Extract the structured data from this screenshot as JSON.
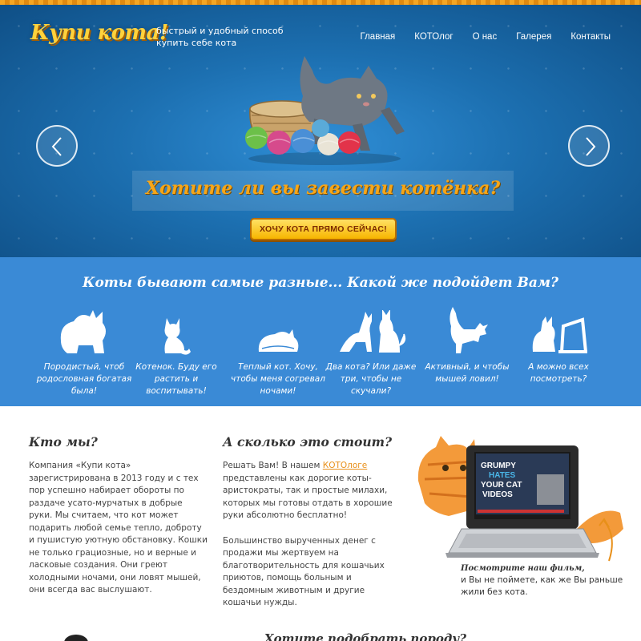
{
  "header": {
    "logo": "Купи кота!",
    "tagline": "быстрый и удобный способ купить себе кота",
    "nav": [
      "Главная",
      "КОТОлог",
      "О нас",
      "Галерея",
      "Контакты"
    ]
  },
  "hero": {
    "title": "Хотите ли вы завести котёнка?",
    "cta": "ХОЧУ КОТА ПРЯМО СЕЙЧАС!"
  },
  "breeds": {
    "title": "Коты бывают самые разные... Какой же подойдет Вам?",
    "items": [
      {
        "icon": "fluffy-cat-icon",
        "caption": "Породистый, чтоб родословная богатая была!"
      },
      {
        "icon": "kitten-icon",
        "caption": "Котенок. Буду его растить и воспитывать!"
      },
      {
        "icon": "sleeping-cat-icon",
        "caption": "Теплый кот. Хочу, чтобы меня согревал ночами!"
      },
      {
        "icon": "two-cats-icon",
        "caption": "Два кота? Или даже три, чтобы не скучали?"
      },
      {
        "icon": "active-cat-icon",
        "caption": "Активный, и чтобы мышей ловил!"
      },
      {
        "icon": "cat-laptop-icon",
        "caption": "А можно всех посмотреть?"
      }
    ]
  },
  "about": {
    "title": "Кто мы?",
    "text": "Компания «Купи кота» зарегистрирована в 2013 году и с тех пор успешно набирает обороты по раздаче усато-мурчатых в добрые руки. Мы считаем, что кот может подарить любой семье тепло, доброту и пушистую уютную обстановку. Кошки не только грациозные, но и верные и ласковые создания. Они греют холодными ночами, они ловят мышей, они всегда вас выслушают."
  },
  "price": {
    "title": "А сколько это стоит?",
    "p1_before": "Решать Вам! В нашем ",
    "p1_link": "КОТОлоге",
    "p1_after": " представлены как дорогие коты-аристократы, так и простые милахи, которых мы готовы отдать в хорошие руки абсолютно бесплатно!",
    "p2": "Большинство вырученных денег с продажи мы жертвуем на благотворительность для кошачьих приютов, помощь больным и бездомным животным и другие кошачьи нужды."
  },
  "video": {
    "screen_lines": [
      "GRUMPY",
      "HATES",
      "YOUR CAT",
      "VIDEOS"
    ],
    "caption_em": "Посмотрите наш фильм,",
    "caption_rest": "и Вы не поймете, как же Вы раньше жили без кота."
  },
  "bottom": {
    "title": "Хотите подобрать породу?"
  },
  "colors": {
    "accent": "#f7a617",
    "hero_blue": "#1c6fb0",
    "band_blue": "#3a8ad6",
    "link": "#e8901a"
  }
}
